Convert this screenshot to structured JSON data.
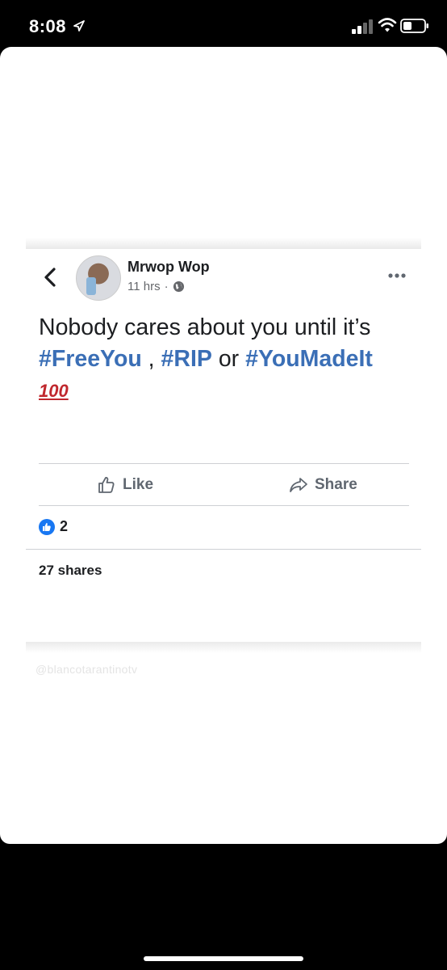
{
  "status_bar": {
    "time": "8:08"
  },
  "post": {
    "author": "Mrwop Wop",
    "time": "11 hrs",
    "separator": "·",
    "text_plain_1": "Nobody cares about you until it’s",
    "hashtag_1": "#FreeYou",
    "text_plain_2": " , ",
    "hashtag_2": "#RIP",
    "text_plain_3": " or ",
    "hashtag_3": "#YouMadeIt",
    "emoji": "100",
    "like_label": "Like",
    "share_label": "Share",
    "reaction_count": "2",
    "shares_text": "27 shares"
  },
  "watermark": "@blancotarantinotv",
  "colors": {
    "hashtag": "#3b6fb6",
    "like_badge": "#1877f2"
  }
}
